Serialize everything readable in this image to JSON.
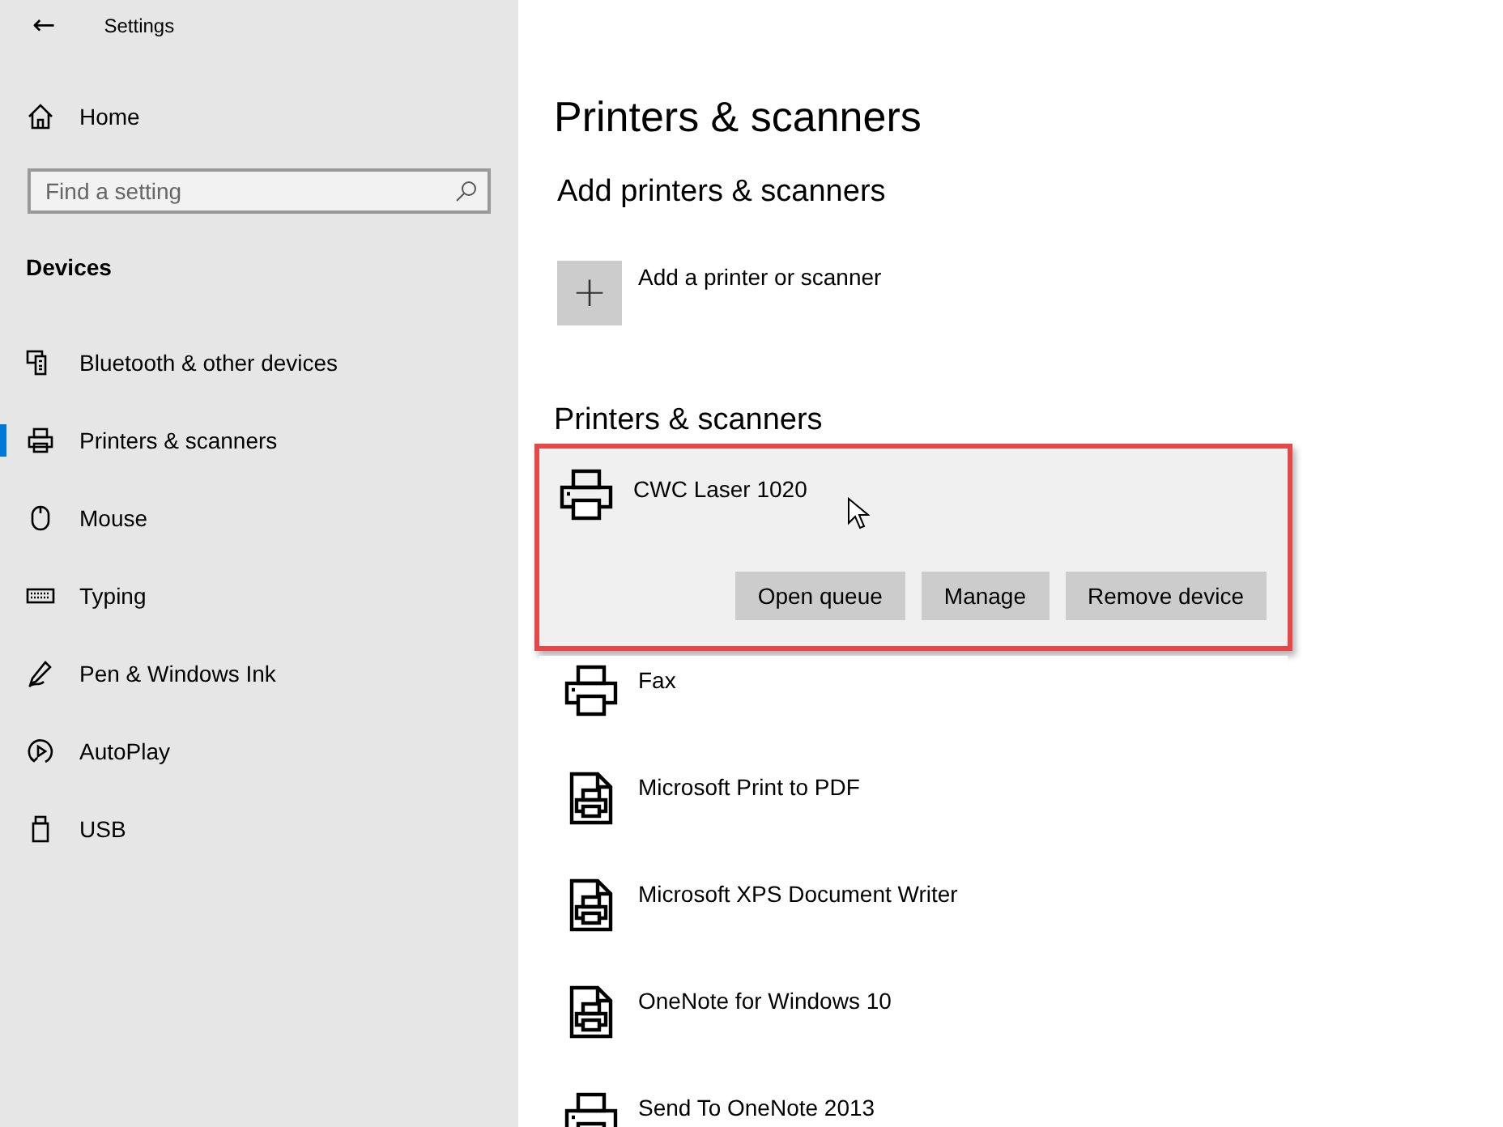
{
  "window": {
    "title": "Settings",
    "back": "←"
  },
  "sidebar": {
    "home": "Home",
    "search": {
      "placeholder": "Find a setting"
    },
    "section": "Devices",
    "items": [
      {
        "label": "Bluetooth & other devices",
        "kind": "devices",
        "selected": false
      },
      {
        "label": "Printers & scanners",
        "kind": "printer",
        "selected": true
      },
      {
        "label": "Mouse",
        "kind": "mouse",
        "selected": false
      },
      {
        "label": "Typing",
        "kind": "keyboard",
        "selected": false
      },
      {
        "label": "Pen & Windows Ink",
        "kind": "pen",
        "selected": false
      },
      {
        "label": "AutoPlay",
        "kind": "autoplay",
        "selected": false
      },
      {
        "label": "USB",
        "kind": "usb",
        "selected": false
      }
    ]
  },
  "main": {
    "title": "Printers & scanners",
    "add_heading": "Add printers & scanners",
    "add_label": "Add a printer or scanner",
    "add_symbol": "+",
    "list_heading": "Printers & scanners",
    "printers": [
      {
        "name": "CWC Laser 1020",
        "kind": "printer",
        "selected": true,
        "highlighted": true,
        "buttons": [
          "Open queue",
          "Manage",
          "Remove device"
        ]
      },
      {
        "name": "Fax",
        "kind": "printer",
        "selected": false,
        "highlighted": false
      },
      {
        "name": "Microsoft Print to PDF",
        "kind": "document",
        "selected": false,
        "highlighted": false
      },
      {
        "name": "Microsoft XPS Document Writer",
        "kind": "document",
        "selected": false,
        "highlighted": false
      },
      {
        "name": "OneNote for Windows 10",
        "kind": "document",
        "selected": false,
        "highlighted": false
      },
      {
        "name": "Send To OneNote 2013",
        "kind": "printer",
        "selected": false,
        "highlighted": false
      }
    ]
  }
}
